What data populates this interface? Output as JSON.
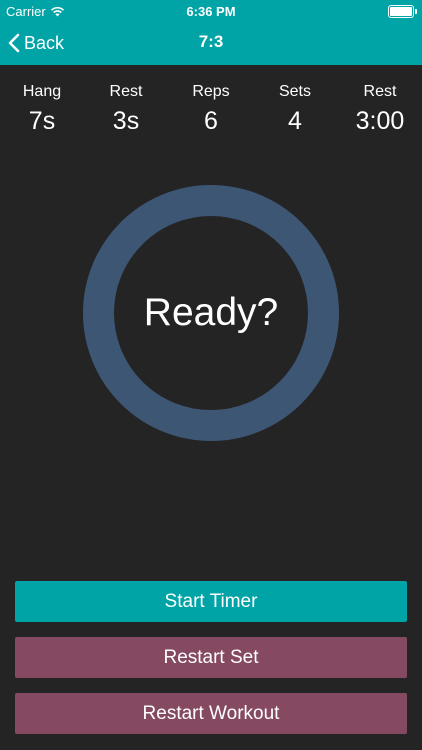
{
  "status_bar": {
    "carrier": "Carrier",
    "time": "6:36 PM"
  },
  "nav": {
    "back_label": "Back",
    "title": "7:3"
  },
  "stats": [
    {
      "label": "Hang",
      "value": "7s"
    },
    {
      "label": "Rest",
      "value": "3s"
    },
    {
      "label": "Reps",
      "value": "6"
    },
    {
      "label": "Sets",
      "value": "4"
    },
    {
      "label": "Rest",
      "value": "3:00"
    }
  ],
  "timer": {
    "text": "Ready?"
  },
  "buttons": {
    "start": "Start Timer",
    "restart_set": "Restart Set",
    "restart_workout": "Restart Workout"
  },
  "colors": {
    "accent": "#00a3a6",
    "background": "#242424",
    "ring": "#3c5674",
    "restart": "#854a62"
  },
  "icons": {
    "wifi": "wifi-icon",
    "battery": "battery-icon",
    "back": "chevron-left-icon"
  }
}
